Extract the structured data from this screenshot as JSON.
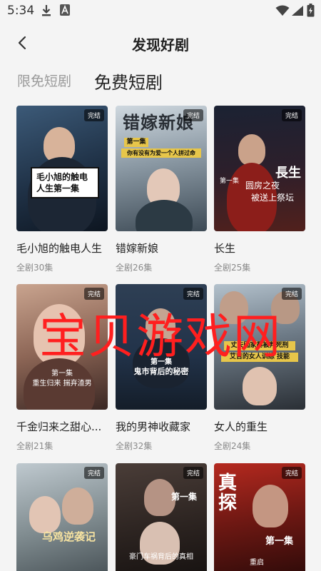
{
  "status_bar": {
    "time": "5:34",
    "icons": [
      "download-icon",
      "a-letter-icon",
      "wifi-icon",
      "signal-icon",
      "battery-icon"
    ]
  },
  "header": {
    "back_icon": "chevron-left-icon",
    "title": "发现好剧"
  },
  "tabs": [
    {
      "label": "限免短剧",
      "active": false
    },
    {
      "label": "免费短剧",
      "active": true
    }
  ],
  "dramas": [
    {
      "title": "毛小旭的触电人生",
      "count": "全剧30集",
      "badge": "完结",
      "poster_caption": "毛小旭的触电人生第一集"
    },
    {
      "title": "错嫁新娘",
      "count": "全剧26集",
      "badge": "完结",
      "poster_logo": "错嫁新娘",
      "poster_band_1": "第一集",
      "poster_band_2": "你有没有为爱一个人拼过命"
    },
    {
      "title": "长生",
      "count": "全剧25集",
      "badge": "完结",
      "poster_logo": "長生",
      "poster_line_1": "第一集",
      "poster_line_2": "圆房之夜",
      "poster_line_3": "被送上祭坛"
    },
    {
      "title": "千金归来之甜心...",
      "count": "全剧21集",
      "badge": "完结",
      "poster_line_1": "第一集",
      "poster_line_2": "重生归来 揣弃渣男"
    },
    {
      "title": "我的男神收藏家",
      "count": "全剧32集",
      "badge": "完结",
      "poster_line_1": "第一集",
      "poster_line_2": "鬼市背后的秘密"
    },
    {
      "title": "女人的重生",
      "count": "全剧24集",
      "badge": "完结",
      "poster_band_1": "丈夫因家暴被判死刑",
      "poster_band_2": "艾吉的女人训练 技能"
    },
    {
      "title": "",
      "count": "",
      "badge": "完结",
      "poster_logo": "乌鸡逆袭记"
    },
    {
      "title": "",
      "count": "",
      "badge": "完结",
      "poster_line_1": "第一集",
      "poster_line_2": "豪门车祸背后的真相"
    },
    {
      "title": "",
      "count": "",
      "badge": "完结",
      "poster_logo": "真探",
      "poster_line_1": "第一集",
      "poster_line_2": "重启"
    }
  ],
  "watermark": "宝贝游戏网",
  "colors": {
    "background": "#f4f4f4",
    "watermark": "#ff1f1f",
    "tab_inactive": "#9a9a9a",
    "meta_text": "#8a8a8a"
  }
}
